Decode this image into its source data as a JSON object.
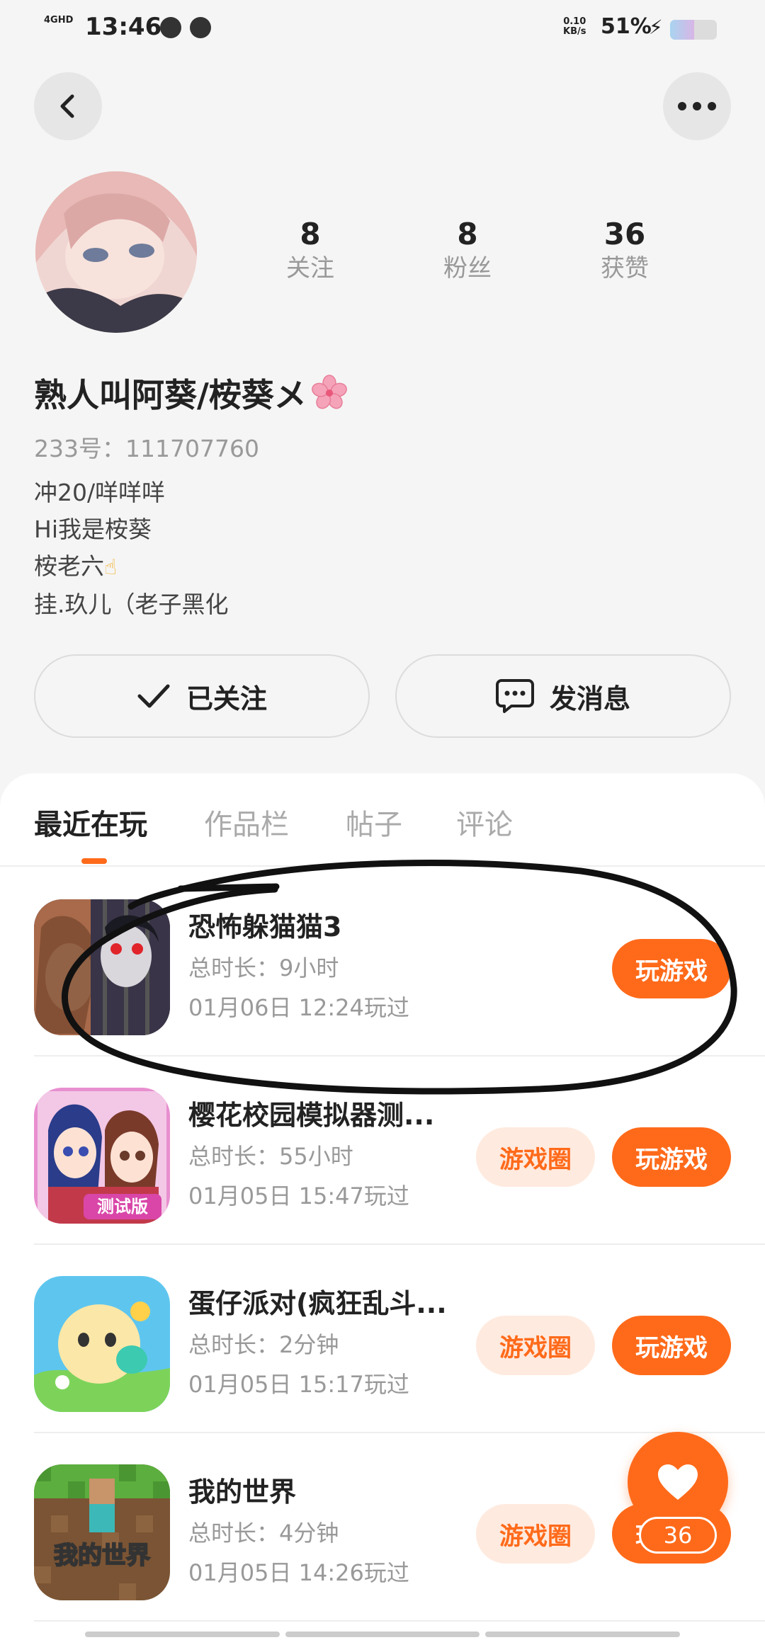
{
  "status_bar": {
    "network": "4GHD",
    "time": "13:46",
    "speed_value": "0.10",
    "speed_unit": "KB/s",
    "battery": "51%"
  },
  "profile": {
    "stats": [
      {
        "value": "8",
        "label": "关注"
      },
      {
        "value": "8",
        "label": "粉丝"
      },
      {
        "value": "36",
        "label": "获赞"
      }
    ],
    "nickname": "熟人叫阿葵/桉葵メ",
    "uid": "233号：111707760",
    "bio": [
      "冲20/咩咩咩",
      "Hi我是桉葵",
      "桉老六",
      "挂.玖儿（老子黑化"
    ]
  },
  "actions": {
    "follow_label": "已关注",
    "message_label": "发消息"
  },
  "tabs": [
    "最近在玩",
    "作品栏",
    "帖子",
    "评论"
  ],
  "games": [
    {
      "name": "恐怖躲猫猫3",
      "duration": "总时长：9小时",
      "last_played": "01月06日 12:24玩过",
      "circle": null,
      "play": "玩游戏"
    },
    {
      "name": "樱花校园模拟器测...",
      "duration": "总时长：55小时",
      "last_played": "01月05日 15:47玩过",
      "circle": "游戏圈",
      "play": "玩游戏"
    },
    {
      "name": "蛋仔派对(疯狂乱斗...",
      "duration": "总时长：2分钟",
      "last_played": "01月05日 15:17玩过",
      "circle": "游戏圈",
      "play": "玩游戏"
    },
    {
      "name": "我的世界",
      "duration": "总时长：4分钟",
      "last_played": "01月05日 14:26玩过",
      "circle": "游戏圈",
      "play": "玩游戏"
    }
  ],
  "game_icon_text": {
    "sakura_badge": "测试版",
    "minecraft_logo": "我的世界"
  },
  "like_fab": {
    "count": "36"
  },
  "colors": {
    "accent": "#ff6a1a",
    "accent_light": "#ffeadf"
  }
}
